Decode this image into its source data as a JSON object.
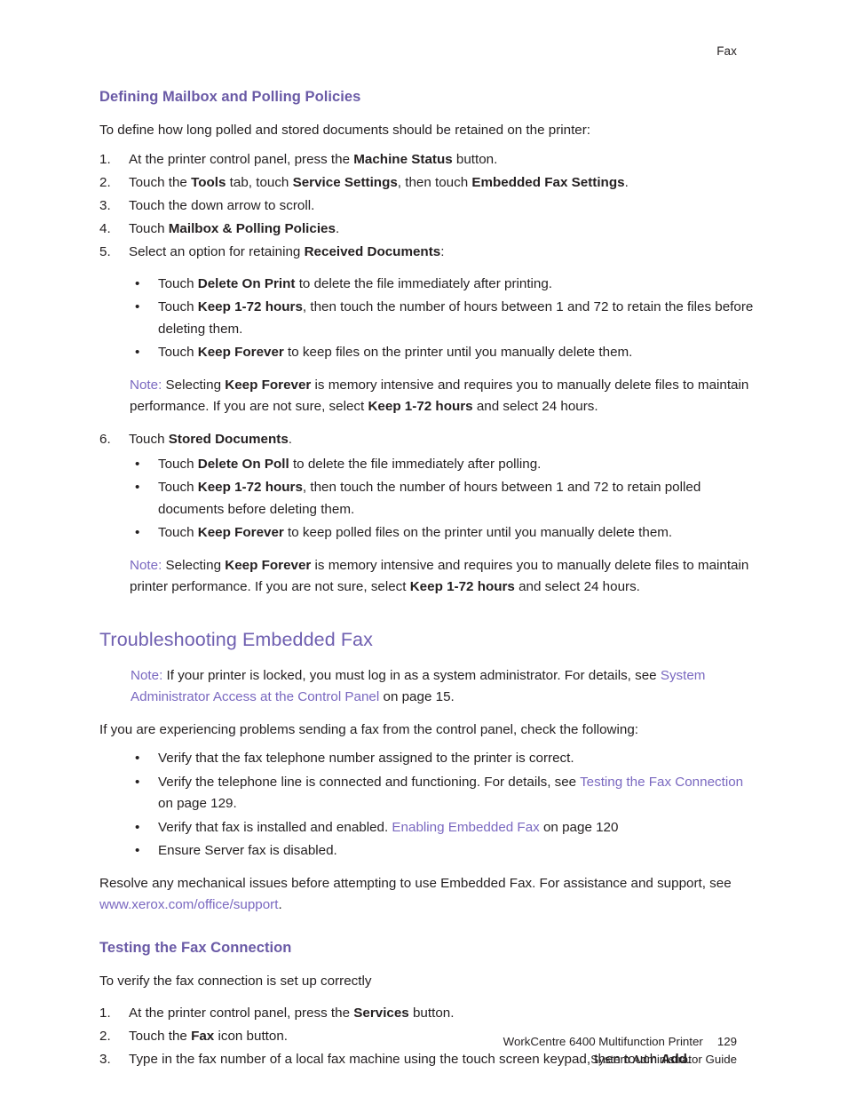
{
  "header": {
    "running_head": "Fax"
  },
  "sections": {
    "mailbox": {
      "heading": "Defining Mailbox and Polling Policies",
      "intro": "To define how long polled and stored documents should be retained on the printer:",
      "steps": [
        {
          "num": "1.",
          "text_parts": [
            "At the printer control panel, press the ",
            "Machine Status",
            " button."
          ]
        },
        {
          "num": "2.",
          "text": "Touch the Tools tab, touch Service Settings, then touch Embedded Fax Settings."
        },
        {
          "num": "3.",
          "text": "Touch the down arrow to scroll."
        },
        {
          "num": "4.",
          "text": "Touch Mailbox & Polling Policies."
        },
        {
          "num": "5.",
          "text": "Select an option for retaining Received Documents:"
        },
        {
          "num": "6.",
          "text": "Touch Stored Documents."
        }
      ],
      "received_bullets": [
        "Touch Delete On Print to delete the file immediately after printing.",
        "Touch Keep 1-72 hours, then touch the number of hours between 1 and 72 to retain the files before deleting them.",
        "Touch Keep Forever to keep files on the printer until you manually delete them."
      ],
      "received_note": "Note: Selecting Keep Forever is memory intensive and requires you to manually delete files to maintain performance. If you are not sure, select Keep 1-72 hours and select 24 hours.",
      "stored_bullets": [
        "Touch Delete On Poll to delete the file immediately after polling.",
        "Touch Keep 1-72 hours, then touch the number of hours between 1 and 72 to retain polled documents before deleting them.",
        "Touch Keep Forever to keep polled files on the printer until you manually delete them."
      ],
      "stored_note": "Note: Selecting Keep Forever is memory intensive and requires you to manually delete files to maintain printer performance. If you are not sure, select Keep 1-72 hours and select 24 hours."
    },
    "troubleshooting": {
      "heading": "Troubleshooting Embedded Fax",
      "note": "Note: If your printer is locked, you must log in as a system administrator. For details, see System Administrator Access at the Control Panel on page 15.",
      "note_label": "Note:",
      "note_text_1": "If your printer is locked, you must log in as a system administrator. For details, see",
      "note_link": "System Administrator Access at the Control Panel",
      "note_text_2": "on page 15.",
      "intro": "If you are experiencing problems sending a fax from the control panel, check the following:",
      "bullets": [
        {
          "text": "Verify that the fax telephone number assigned to the printer is correct."
        },
        {
          "pre": "Verify the telephone line is connected and functioning. For details, see ",
          "link": "Testing the Fax Connection",
          "post": " on page 129."
        },
        {
          "pre": "Verify that fax is installed and enabled. ",
          "link": "Enabling Embedded Fax",
          "post": " on page 120"
        },
        {
          "text": "Ensure Server fax is disabled."
        }
      ],
      "closing_pre": "Resolve any mechanical issues before attempting to use Embedded Fax. For assistance and support, see ",
      "closing_link": "www.xerox.com/office/support",
      "closing_post": "."
    },
    "testing": {
      "heading": "Testing the Fax Connection",
      "intro": "To verify the fax connection is set up correctly",
      "steps": [
        {
          "num": "1.",
          "pre": "At the printer control panel, press the ",
          "bold": "Services",
          "post": " button."
        },
        {
          "num": "2.",
          "pre": "Touch the ",
          "bold": "Fax",
          "post": " icon button."
        },
        {
          "num": "3.",
          "pre": "Type in the fax number of a local fax machine using the touch screen keypad, then touch ",
          "bold": "Add",
          "post": "."
        }
      ]
    }
  },
  "footer": {
    "product": "WorkCentre 6400 Multifunction Printer",
    "page_number": "129",
    "guide": "System Administrator Guide"
  },
  "colors": {
    "heading_purple": "#6f5fb0",
    "subheading_purple": "#6a5aa6",
    "link_purple": "#7a68c0",
    "body_black": "#231f20"
  },
  "bullet_glyph": "•"
}
